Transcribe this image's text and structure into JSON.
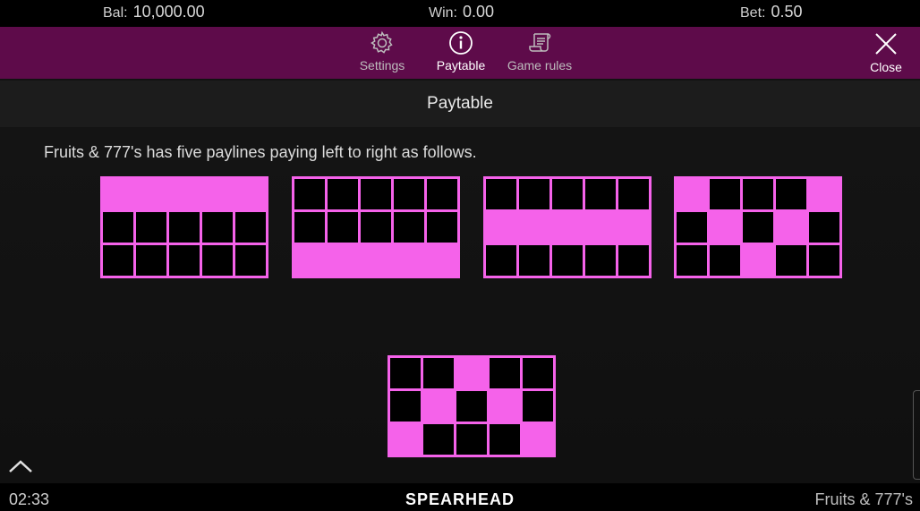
{
  "status": {
    "balance_label": "Bal:",
    "balance_value": "10,000.00",
    "win_label": "Win:",
    "win_value": "0.00",
    "bet_label": "Bet:",
    "bet_value": "0.50"
  },
  "menu": {
    "settings": "Settings",
    "paytable": "Paytable",
    "rules": "Game rules",
    "close": "Close",
    "active": "paytable"
  },
  "page": {
    "title": "Paytable",
    "intro": "Fruits & 777's has five paylines paying left to right as follows."
  },
  "paylines": [
    {
      "rows": [
        0,
        0,
        0,
        0,
        0
      ]
    },
    {
      "rows": [
        2,
        2,
        2,
        2,
        2
      ]
    },
    {
      "rows": [
        1,
        1,
        1,
        1,
        1
      ]
    },
    {
      "rows": [
        0,
        1,
        2,
        1,
        0
      ]
    },
    {
      "rows": [
        2,
        1,
        0,
        1,
        2
      ]
    }
  ],
  "colors": {
    "highlight": "#f562ea",
    "menubar": "#5e0b4a"
  },
  "footer": {
    "clock": "02:33",
    "brand": "SPEARHEAD",
    "game": "Fruits & 777's"
  }
}
